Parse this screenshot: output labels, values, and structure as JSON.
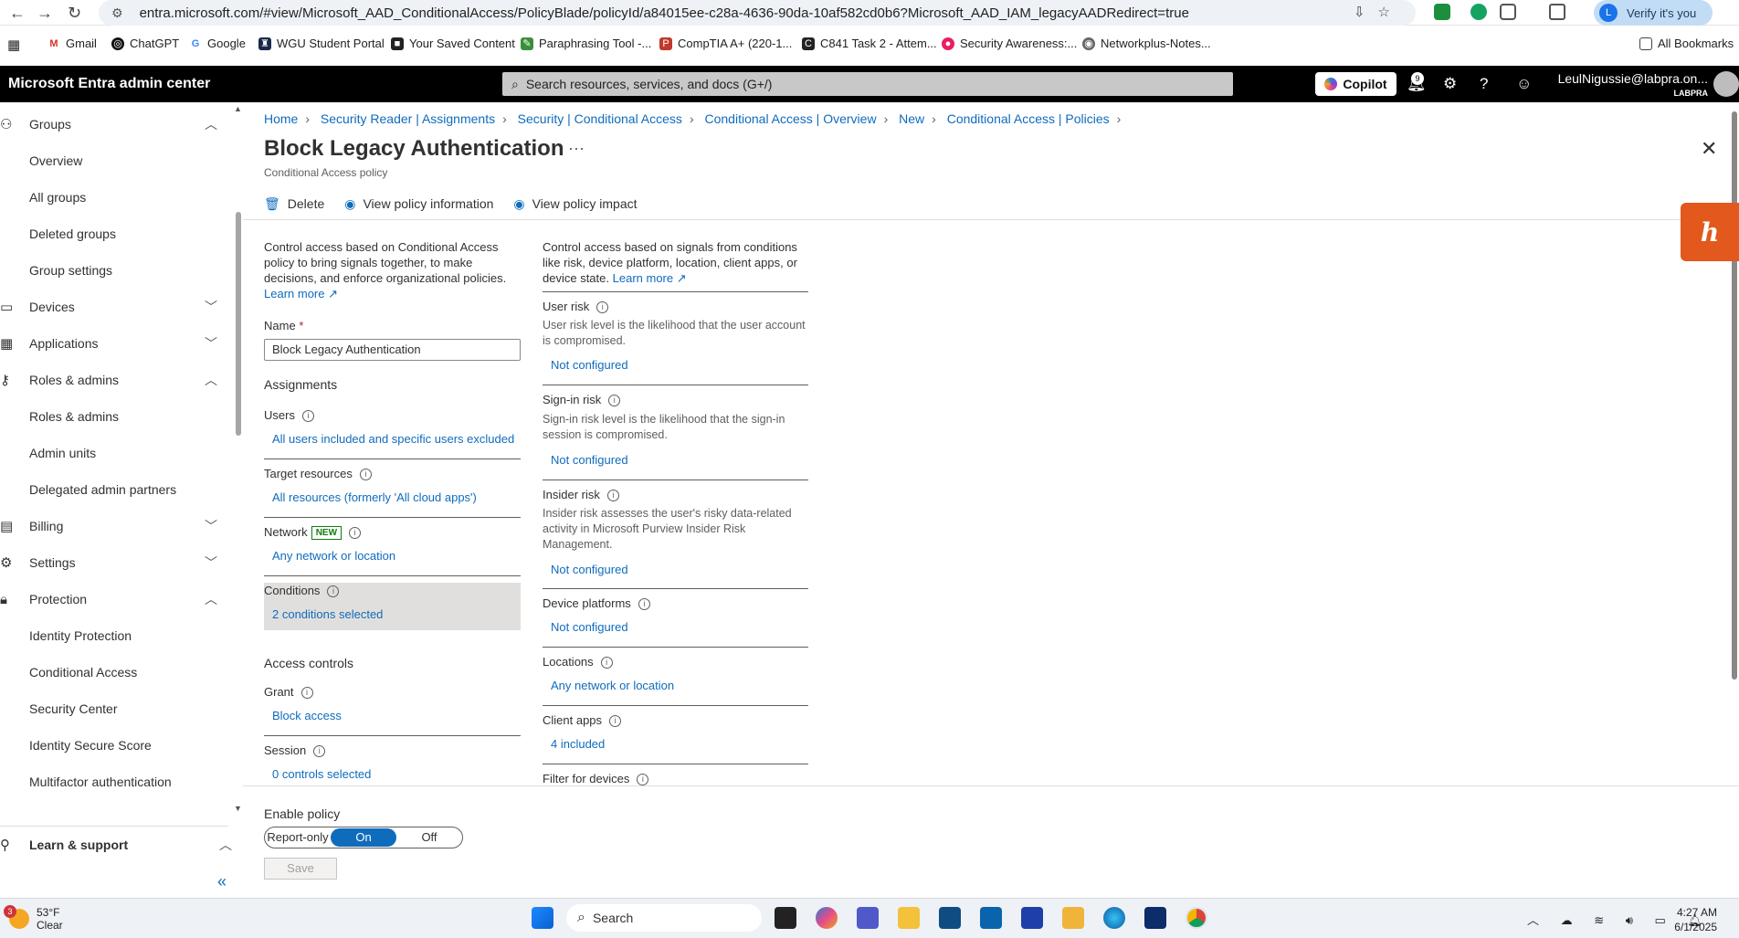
{
  "browser": {
    "url": "entra.microsoft.com/#view/Microsoft_AAD_ConditionalAccess/PolicyBlade/policyId/a84015ee-c28a-4636-90da-10af582cd0b6?Microsoft_AAD_IAM_legacyAADRedirect=true",
    "verify_label": "Verify it's you",
    "profile_initial": "L",
    "bookmarks": [
      "Gmail",
      "ChatGPT",
      "Google",
      "WGU Student Portal",
      "Your Saved Content",
      "Paraphrasing Tool -...",
      "CompTIA A+ (220-1...",
      "C841 Task 2 - Attem...",
      "Security Awareness:...",
      "Networkplus-Notes..."
    ],
    "all_bookmarks": "All Bookmarks"
  },
  "portal": {
    "brand": "Microsoft Entra admin center",
    "search_placeholder": "Search resources, services, and docs (G+/)",
    "copilot": "Copilot",
    "notifications_count": "9",
    "user_name": "LeulNigussie@labpra.on...",
    "tenant": "LABPRA"
  },
  "sidebar": {
    "groups_label": "Groups",
    "groups_items": [
      "Overview",
      "All groups",
      "Deleted groups",
      "Group settings"
    ],
    "devices": "Devices",
    "applications": "Applications",
    "roles_label": "Roles & admins",
    "roles_items": [
      "Roles & admins",
      "Admin units",
      "Delegated admin partners"
    ],
    "billing": "Billing",
    "settings": "Settings",
    "protection_label": "Protection",
    "protection_items": [
      "Identity Protection",
      "Conditional Access",
      "Security Center",
      "Identity Secure Score",
      "Multifactor authentication"
    ],
    "learn": "Learn & support"
  },
  "breadcrumb": [
    "Home",
    "Security Reader | Assignments",
    "Security | Conditional Access",
    "Conditional Access | Overview",
    "New",
    "Conditional Access | Policies"
  ],
  "page": {
    "title": "Block Legacy Authentication",
    "subtitle": "Conditional Access policy",
    "commands": [
      "Delete",
      "View policy information",
      "View policy impact"
    ]
  },
  "left_col": {
    "intro": "Control access based on Conditional Access policy to bring signals together, to make decisions, and enforce organizational policies.",
    "learn_more": "Learn more",
    "name_label": "Name",
    "name_value": "Block Legacy Authentication",
    "assignments": "Assignments",
    "users_label": "Users",
    "users_value": "All users included and specific users excluded",
    "target_label": "Target resources",
    "target_value": "All resources (formerly 'All cloud apps')",
    "network_label": "Network",
    "network_badge": "NEW",
    "network_value": "Any network or location",
    "conditions_label": "Conditions",
    "conditions_value": "2 conditions selected",
    "access_controls": "Access controls",
    "grant_label": "Grant",
    "grant_value": "Block access",
    "session_label": "Session",
    "session_value": "0 controls selected"
  },
  "right_col": {
    "intro": "Control access based on signals from conditions like risk, device platform, location, client apps, or device state.",
    "learn_more": "Learn more",
    "user_risk_label": "User risk",
    "user_risk_desc": "User risk level is the likelihood that the user account is compromised.",
    "user_risk_value": "Not configured",
    "signin_risk_label": "Sign-in risk",
    "signin_risk_desc": "Sign-in risk level is the likelihood that the sign-in session is compromised.",
    "signin_risk_value": "Not configured",
    "insider_risk_label": "Insider risk",
    "insider_risk_desc": "Insider risk assesses the user's risky data-related activity in Microsoft Purview Insider Risk Management.",
    "insider_risk_value": "Not configured",
    "device_platforms_label": "Device platforms",
    "device_platforms_value": "Not configured",
    "locations_label": "Locations",
    "locations_value": "Any network or location",
    "client_apps_label": "Client apps",
    "client_apps_value": "4 included",
    "filter_devices_label": "Filter for devices"
  },
  "footer": {
    "enable_policy": "Enable policy",
    "toggle": [
      "Report-only",
      "On",
      "Off"
    ],
    "save": "Save"
  },
  "taskbar": {
    "temp": "53°F",
    "condition": "Clear",
    "weather_badge": "3",
    "search": "Search",
    "time": "4:27 AM",
    "date": "6/1/2025"
  },
  "colors": {
    "accent": "#0f6cbd",
    "header_bg": "#000000",
    "honey": "#e3581c"
  }
}
